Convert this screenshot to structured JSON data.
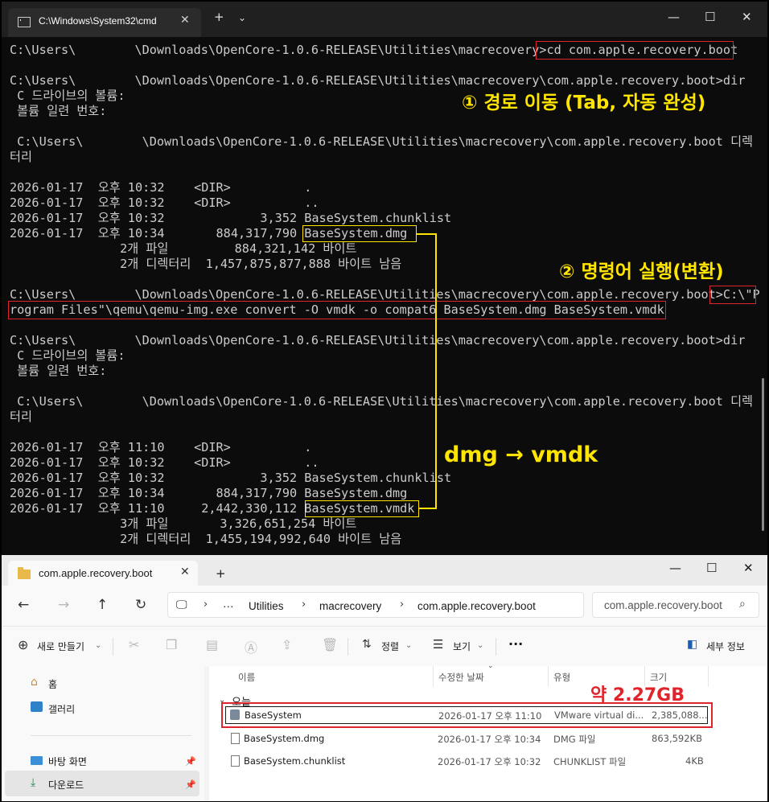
{
  "colors": {
    "terminal_bg": "#0c0c0c",
    "terminal_text": "#cccccc",
    "highlight_red": "#e0242b",
    "annotation_yellow": "#ffe500",
    "explorer_bg": "#f3f3f3"
  },
  "terminal": {
    "tab_title": "C:\\Windows\\System32\\cmd",
    "tab_icon": "cmd-icon",
    "lines": [
      "C:\\Users\\        \\Downloads\\OpenCore-1.0.6-RELEASE\\Utilities\\macrecovery>cd com.apple.recovery.boot",
      "",
      "C:\\Users\\        \\Downloads\\OpenCore-1.0.6-RELEASE\\Utilities\\macrecovery\\com.apple.recovery.boot>dir",
      " C 드라이브의 볼륨:",
      " 볼륨 일련 번호:",
      "",
      " C:\\Users\\        \\Downloads\\OpenCore-1.0.6-RELEASE\\Utilities\\macrecovery\\com.apple.recovery.boot 디렉",
      "터리",
      "",
      "2026-01-17  오후 10:32    <DIR>          .",
      "2026-01-17  오후 10:32    <DIR>          ..",
      "2026-01-17  오후 10:32             3,352 BaseSystem.chunklist",
      "2026-01-17  오후 10:34       884,317,790 BaseSystem.dmg",
      "               2개 파일         884,321,142 바이트",
      "               2개 디렉터리  1,457,875,877,888 바이트 남음",
      "",
      "C:\\Users\\        \\Downloads\\OpenCore-1.0.6-RELEASE\\Utilities\\macrecovery\\com.apple.recovery.boot>C:\\\"P",
      "rogram Files\"\\qemu\\qemu-img.exe convert -O vmdk -o compat6 BaseSystem.dmg BaseSystem.vmdk",
      "",
      "C:\\Users\\        \\Downloads\\OpenCore-1.0.6-RELEASE\\Utilities\\macrecovery\\com.apple.recovery.boot>dir",
      " C 드라이브의 볼륨:",
      " 볼륨 일련 번호:",
      "",
      " C:\\Users\\        \\Downloads\\OpenCore-1.0.6-RELEASE\\Utilities\\macrecovery\\com.apple.recovery.boot 디렉",
      "터리",
      "",
      "2026-01-17  오후 11:10    <DIR>          .",
      "2026-01-17  오후 10:32    <DIR>          ..",
      "2026-01-17  오후 10:32             3,352 BaseSystem.chunklist",
      "2026-01-17  오후 10:34       884,317,790 BaseSystem.dmg",
      "2026-01-17  오후 11:10     2,442,330,112 BaseSystem.vmdk",
      "               3개 파일       3,326,651,254 바이트",
      "               2개 디렉터리  1,455,194,992,640 바이트 남음"
    ],
    "annotations": {
      "step1": "① 경로 이동 (Tab, 자동 완성)",
      "step2": "② 명령어 실행(변환)",
      "convert": "dmg → vmdk"
    }
  },
  "explorer": {
    "tab_title": "com.apple.recovery.boot",
    "breadcrumbs": [
      "Utilities",
      "macrecovery",
      "com.apple.recovery.boot"
    ],
    "breadcrumb_more": "···",
    "search_placeholder": "com.apple.recovery.boot",
    "toolbar": {
      "new_label": "새로 만들기",
      "sort_label": "정렬",
      "view_label": "보기",
      "more_label": "···",
      "details_label": "세부 정보"
    },
    "nav_items": [
      {
        "label": "홈",
        "icon": "home-icon"
      },
      {
        "label": "갤러리",
        "icon": "gallery-icon"
      },
      {
        "label": "바탕 화면",
        "icon": "desktop-icon"
      },
      {
        "label": "다운로드",
        "icon": "download-icon"
      }
    ],
    "columns": [
      "이름",
      "수정한 날짜",
      "유형",
      "크기"
    ],
    "group_label": "오늘",
    "size_annotation": "약 2.27GB",
    "files": [
      {
        "name": "BaseSystem",
        "date": "2026-01-17 오후 11:10",
        "type": "VMware virtual di...",
        "size": "2,385,088..."
      },
      {
        "name": "BaseSystem.dmg",
        "date": "2026-01-17 오후 10:34",
        "type": "DMG 파일",
        "size": "863,592KB"
      },
      {
        "name": "BaseSystem.chunklist",
        "date": "2026-01-17 오후 10:32",
        "type": "CHUNKLIST 파일",
        "size": "4KB"
      }
    ]
  }
}
